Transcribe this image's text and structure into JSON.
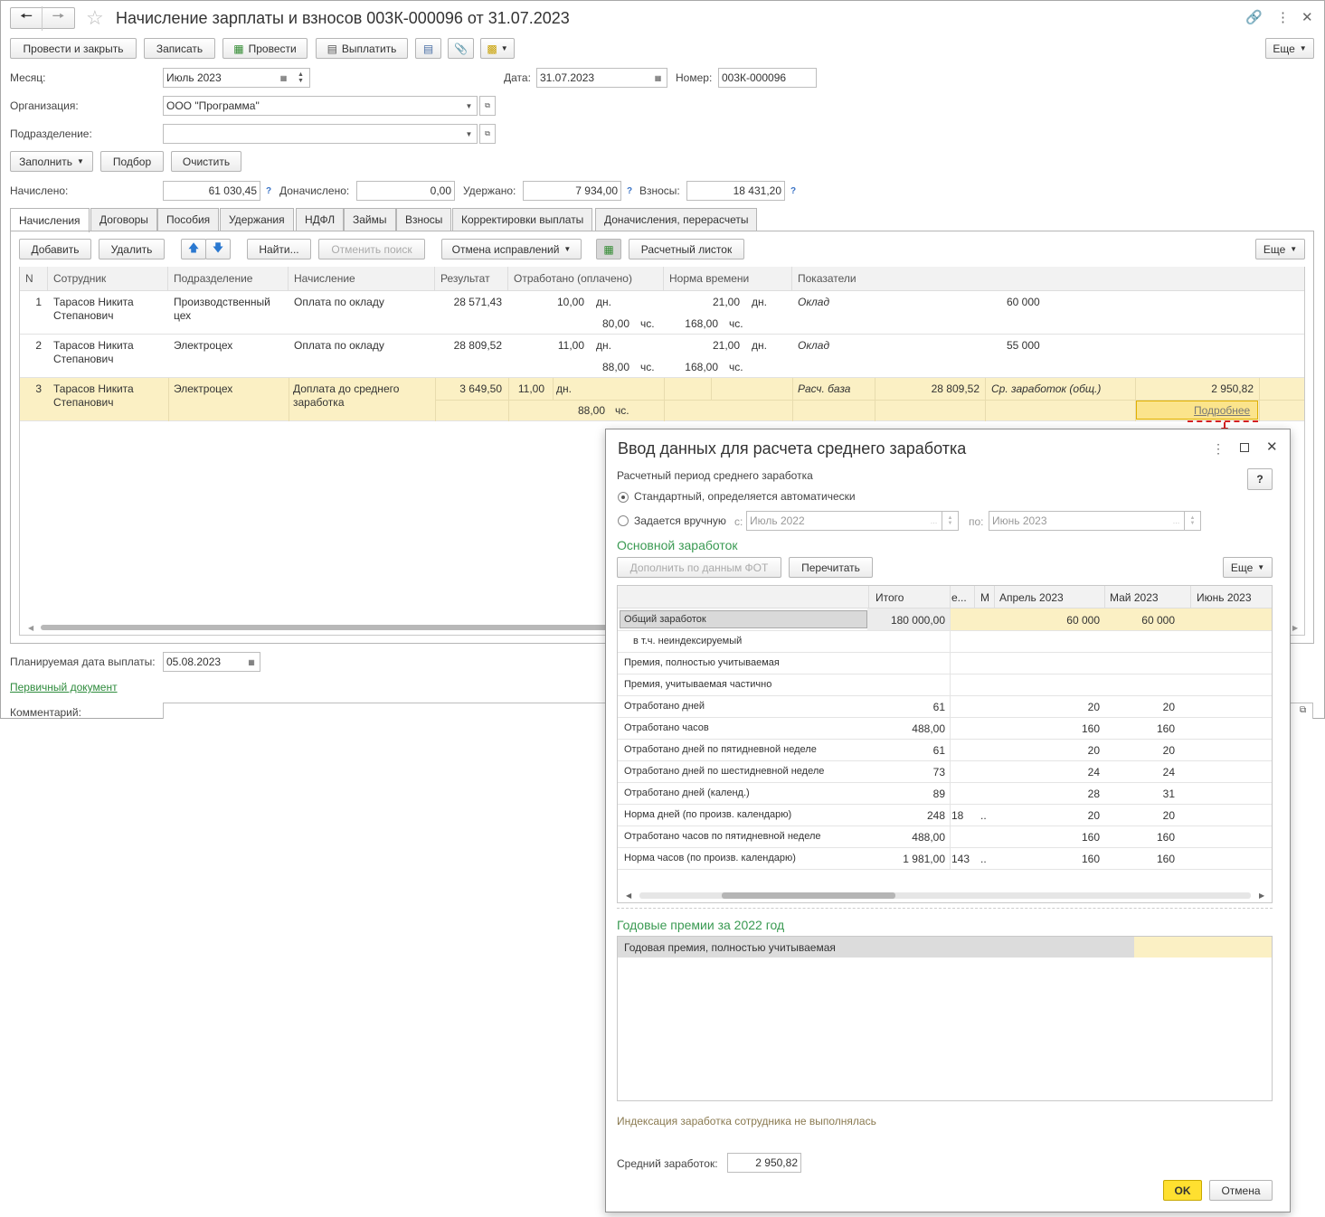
{
  "window": {
    "title": "Начисление зарплаты и взносов 003К-000096 от 31.07.2023",
    "toolbar": {
      "post_close": "Провести и закрыть",
      "save": "Записать",
      "post": "Провести",
      "pay": "Выплатить",
      "more": "Еще"
    },
    "fields": {
      "month_label": "Месяц:",
      "month_value": "Июль 2023",
      "date_label": "Дата:",
      "date_value": "31.07.2023",
      "number_label": "Номер:",
      "number_value": "003К-000096",
      "org_label": "Организация:",
      "org_value": "ООО \"Программа\"",
      "dept_label": "Подразделение:",
      "dept_value": ""
    },
    "actions": {
      "fill": "Заполнить",
      "pick": "Подбор",
      "clear": "Очистить"
    },
    "totals": {
      "accrued_label": "Начислено:",
      "accrued_value": "61 030,45",
      "extra_label": "Доначислено:",
      "extra_value": "0,00",
      "withheld_label": "Удержано:",
      "withheld_value": "7 934,00",
      "contrib_label": "Взносы:",
      "contrib_value": "18 431,20",
      "help": "?"
    },
    "tabs": [
      "Начисления",
      "Договоры",
      "Пособия",
      "Удержания",
      "НДФЛ",
      "Займы",
      "Взносы",
      "Корректировки выплаты",
      "Доначисления, перерасчеты"
    ],
    "table_toolbar": {
      "add": "Добавить",
      "delete": "Удалить",
      "find": "Найти...",
      "cancel_search": "Отменить поиск",
      "cancel_fix": "Отмена исправлений",
      "payslip": "Расчетный листок",
      "more": "Еще"
    },
    "columns": [
      "N",
      "Сотрудник",
      "Подразделение",
      "Начисление",
      "Результат",
      "Отработано (оплачено)",
      "Норма времени",
      "Показатели"
    ],
    "rows": [
      {
        "n": "1",
        "employee_1": "Тарасов Никита",
        "employee_2": "Степанович",
        "dept_1": "Производственный",
        "dept_2": "цех",
        "accrual_1": "Оплата по окладу",
        "accrual_2": "",
        "result": "28 571,43",
        "worked_days": "10,00",
        "days_unit": "дн.",
        "worked_hours": "80,00",
        "hours_unit": "чс.",
        "norm_days": "21,00",
        "norm_days_unit": "дн.",
        "norm_hours": "168,00",
        "norm_hours_unit": "чс.",
        "ind_name": "Оклад",
        "ind_value": "60 000"
      },
      {
        "n": "2",
        "employee_1": "Тарасов Никита",
        "employee_2": "Степанович",
        "dept_1": "Электроцех",
        "dept_2": "",
        "accrual_1": "Оплата по окладу",
        "accrual_2": "",
        "result": "28 809,52",
        "worked_days": "11,00",
        "days_unit": "дн.",
        "worked_hours": "88,00",
        "hours_unit": "чс.",
        "norm_days": "21,00",
        "norm_days_unit": "дн.",
        "norm_hours": "168,00",
        "norm_hours_unit": "чс.",
        "ind_name": "Оклад",
        "ind_value": "55 000"
      },
      {
        "n": "3",
        "employee_1": "Тарасов Никита",
        "employee_2": "Степанович",
        "dept_1": "Электроцех",
        "dept_2": "",
        "accrual_1": "Доплата до среднего",
        "accrual_2": "заработка",
        "result": "3 649,50",
        "worked_days": "11,00",
        "days_unit": "дн.",
        "worked_hours": "88,00",
        "hours_unit": "чс.",
        "ind_name": "Расч. база",
        "ind_value": "28 809,52",
        "ind2_name": "Ср. заработок (общ.)",
        "ind2_value": "2 950,82",
        "details_link": "Подробнее"
      }
    ],
    "footer": {
      "pay_date_label": "Планируемая дата выплаты:",
      "pay_date_value": "05.08.2023",
      "primary_doc": "Первичный документ",
      "comment_label": "Комментарий:"
    }
  },
  "dialog": {
    "title": "Ввод данных для расчета среднего заработка",
    "period_label": "Расчетный период среднего заработка",
    "help": "?",
    "radio_auto": "Стандартный, определяется автоматически",
    "radio_manual": "Задается вручную",
    "from_label": "с:",
    "from_value": "Июль 2022",
    "to_label": "по:",
    "to_value": "Июнь 2023",
    "section_main": "Основной заработок",
    "fill_fot": "Дополнить по данным ФОТ",
    "recalc": "Перечитать",
    "more": "Еще",
    "columns": [
      "Итого",
      "е...",
      "М",
      "Апрель 2023",
      "Май 2023",
      "Июнь 2023"
    ],
    "rows": [
      {
        "label": "Общий заработок",
        "total": "180 000,00",
        "c1": "",
        "apr": "60 000",
        "may": "60 000"
      },
      {
        "label": "в т.ч. неиндексируемый",
        "total": "",
        "c1": "",
        "apr": "",
        "may": ""
      },
      {
        "label": "Премия, полностью учитываемая",
        "total": "",
        "c1": "",
        "apr": "",
        "may": ""
      },
      {
        "label": "Премия, учитываемая частично",
        "total": "",
        "c1": "",
        "apr": "",
        "may": ""
      },
      {
        "label": "Отработано дней",
        "total": "61",
        "c1": "",
        "apr": "20",
        "may": "20"
      },
      {
        "label": "Отработано часов",
        "total": "488,00",
        "c1": "",
        "apr": "160",
        "may": "160"
      },
      {
        "label": "Отработано дней по пятидневной неделе",
        "total": "61",
        "c1": "",
        "apr": "20",
        "may": "20"
      },
      {
        "label": "Отработано дней по шестидневной неделе",
        "total": "73",
        "c1": "",
        "apr": "24",
        "may": "24"
      },
      {
        "label": "Отработано дней (календ.)",
        "total": "89",
        "c1": "",
        "apr": "28",
        "may": "31"
      },
      {
        "label": "Норма дней (по произв. календарю)",
        "total": "248",
        "c1": "18",
        "c2": "..",
        "apr": "20",
        "may": "20"
      },
      {
        "label": "Отработано часов по пятидневной неделе",
        "total": "488,00",
        "c1": "",
        "apr": "160",
        "may": "160"
      },
      {
        "label": "Норма часов (по произв. календарю)",
        "total": "1 981,00",
        "c1": "143",
        "c2": "..",
        "apr": "160",
        "may": "160"
      }
    ],
    "section_bonus": "Годовые премии за 2022 год",
    "bonus_row": "Годовая премия, полностью учитываемая",
    "indexation_note": "Индексация заработка сотрудника не выполнялась",
    "avg_label": "Средний заработок:",
    "avg_value": "2 950,82",
    "ok": "OK",
    "cancel": "Отмена"
  }
}
